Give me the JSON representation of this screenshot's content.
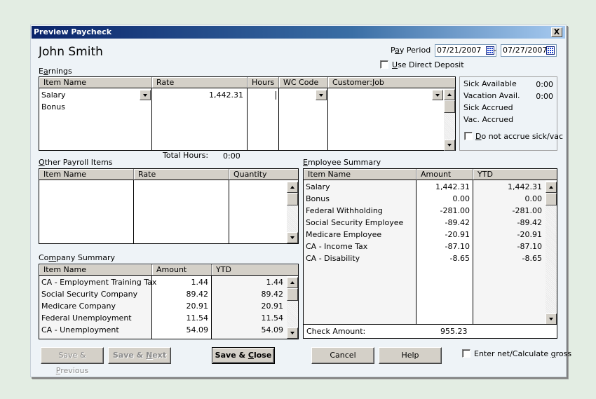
{
  "window": {
    "title": "Preview Paycheck",
    "close_label": "X"
  },
  "employee_name": "John Smith",
  "pay_period": {
    "label_pre": "P",
    "label_ul": "a",
    "label_post": "y Period",
    "start": "07/21/2007",
    "separator": "-",
    "end": "07/27/2007"
  },
  "direct_deposit": {
    "label_ul": "U",
    "label_post": "se Direct Deposit",
    "checked": false
  },
  "earnings": {
    "title_pre": "E",
    "title_ul": "a",
    "title_post": "rnings",
    "columns": [
      "Item Name",
      "Rate",
      "Hours",
      "WC Code",
      "Customer:Job"
    ],
    "rows": [
      {
        "item": "Salary",
        "rate": "1,442.31",
        "hours": "",
        "wc_code": "",
        "customer_job": ""
      },
      {
        "item": "Bonus",
        "rate": "",
        "hours": "",
        "wc_code": "",
        "customer_job": ""
      }
    ],
    "total_hours_label": "Total Hours:",
    "total_hours_value": "0:00"
  },
  "sick_vacation": {
    "sick_available_label": "Sick Available",
    "sick_available_value": "0:00",
    "vacation_avail_label": "Vacation Avail.",
    "vacation_avail_value": "0:00",
    "sick_accrued_label": "Sick Accrued",
    "vac_accrued_label": "Vac. Accrued",
    "do_not_accrue_ul": "D",
    "do_not_accrue_post": "o not accrue sick/vac",
    "do_not_accrue_checked": false
  },
  "other_payroll_items": {
    "title_ul": "O",
    "title_post": "ther Payroll Items",
    "columns": [
      "Item Name",
      "Rate",
      "Quantity"
    ],
    "rows": []
  },
  "company_summary": {
    "title_pre": "Co",
    "title_ul": "m",
    "title_post": "pany Summary",
    "columns": [
      "Item Name",
      "Amount",
      "YTD"
    ],
    "rows": [
      {
        "item": "CA - Employment Training Tax",
        "amount": "1.44",
        "ytd": "1.44"
      },
      {
        "item": "Social Security Company",
        "amount": "89.42",
        "ytd": "89.42"
      },
      {
        "item": "Medicare Company",
        "amount": "20.91",
        "ytd": "20.91"
      },
      {
        "item": "Federal Unemployment",
        "amount": "11.54",
        "ytd": "11.54"
      },
      {
        "item": "CA - Unemployment",
        "amount": "54.09",
        "ytd": "54.09"
      }
    ]
  },
  "employee_summary": {
    "title_ul": "E",
    "title_post": "mployee Summary",
    "columns": [
      "Item Name",
      "Amount",
      "YTD"
    ],
    "rows": [
      {
        "item": "Salary",
        "amount": "1,442.31",
        "ytd": "1,442.31"
      },
      {
        "item": "Bonus",
        "amount": "0.00",
        "ytd": "0.00"
      },
      {
        "item": "Federal Withholding",
        "amount": "-281.00",
        "ytd": "-281.00"
      },
      {
        "item": "Social Security Employee",
        "amount": "-89.42",
        "ytd": "-89.42"
      },
      {
        "item": "Medicare Employee",
        "amount": "-20.91",
        "ytd": "-20.91"
      },
      {
        "item": "CA - Income Tax",
        "amount": "-87.10",
        "ytd": "-87.10"
      },
      {
        "item": "CA - Disability",
        "amount": "-8.65",
        "ytd": "-8.65"
      }
    ],
    "check_amount_label": "Check Amount:",
    "check_amount_value": "955.23"
  },
  "buttons": {
    "save_previous_pre": "Save & ",
    "save_previous_ul": "P",
    "save_previous_post": "revious",
    "save_next_pre": "Save & ",
    "save_next_ul": "N",
    "save_next_post": "ext",
    "save_close_pre": "Save & ",
    "save_close_ul": "C",
    "save_close_post": "lose",
    "cancel": "Cancel",
    "help": "Help"
  },
  "enter_net": {
    "label_pre": "Enter net/Calculate ",
    "label_ul": "g",
    "label_post": "ross",
    "checked": false
  }
}
